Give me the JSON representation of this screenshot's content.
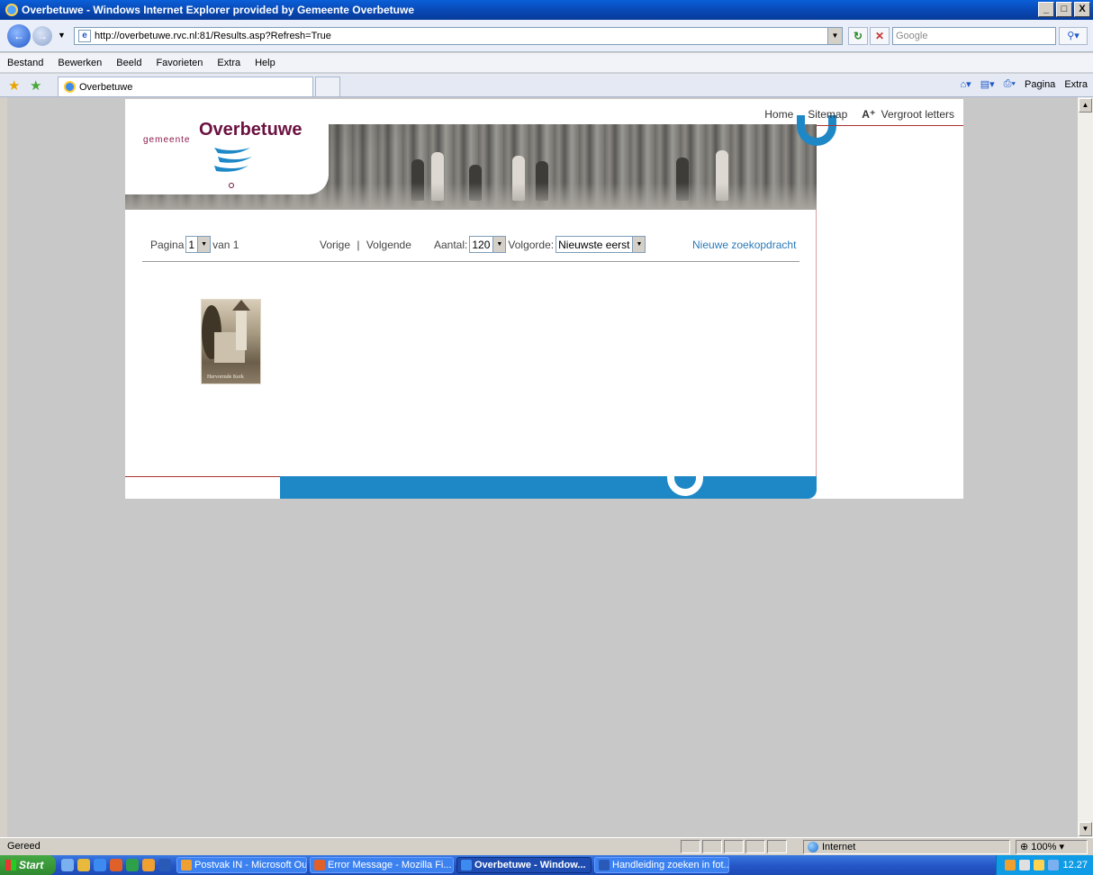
{
  "window": {
    "title": "Overbetuwe - Windows Internet Explorer provided by Gemeente Overbetuwe",
    "controls": [
      "_",
      "□",
      "X"
    ]
  },
  "address": {
    "url": "http://overbetuwe.rvc.nl:81/Results.asp?Refresh=True",
    "search_placeholder": "Google"
  },
  "menu": [
    "Bestand",
    "Bewerken",
    "Beeld",
    "Favorieten",
    "Extra",
    "Help"
  ],
  "tab": {
    "title": "Overbetuwe"
  },
  "commandbar": {
    "pagina": "Pagina",
    "extra": "Extra"
  },
  "site": {
    "logo_small": "gemeente",
    "logo_big": "Overbetuwe",
    "topnav": {
      "home": "Home",
      "sitemap": "Sitemap",
      "a_plus": "A⁺",
      "vergroot": "Vergroot letters"
    },
    "controls": {
      "pagina_label": "Pagina",
      "pagina_value": "1",
      "van": "van 1",
      "vorige": "Vorige",
      "sep": "|",
      "volgende": "Volgende",
      "aantal_label": "Aantal:",
      "aantal_value": "120",
      "volgorde_label": "Volgorde:",
      "volgorde_value": "Nieuwste eerst",
      "nieuwe": "Nieuwe zoekopdracht"
    },
    "results": [
      {
        "caption": "Hervormde Kerk"
      }
    ],
    "colors": {
      "brand_purple": "#6b1240",
      "accent_blue": "#1e88c7",
      "link_blue": "#2a7ab8"
    }
  },
  "status": {
    "text": "Gereed",
    "zone": "Internet",
    "zoom": "100%"
  },
  "taskbar": {
    "start": "Start",
    "tasks": [
      "Postvak IN - Microsoft Ou...",
      "Error Message - Mozilla Fi...",
      "Overbetuwe - Window...",
      "Handleiding zoeken in fot..."
    ],
    "clock": "12.27"
  }
}
